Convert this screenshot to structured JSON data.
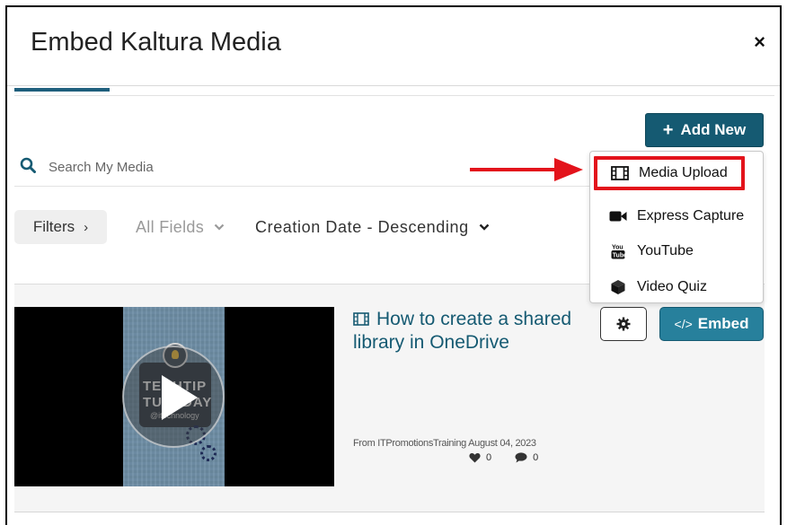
{
  "dialog": {
    "title": "Embed Kaltura Media",
    "close_label": "×"
  },
  "toolbar": {
    "add_new_label": "Add New",
    "search_placeholder": "Search My Media"
  },
  "filters": {
    "filters_label": "Filters",
    "fields_label": "All Fields",
    "sort_label": "Creation Date - Descending"
  },
  "add_new_menu": {
    "items": [
      {
        "label": "Media Upload",
        "icon": "film-icon",
        "highlighted": true
      },
      {
        "label": "Express Capture",
        "icon": "video-camera-icon"
      },
      {
        "label": "YouTube",
        "icon": "youtube-icon"
      },
      {
        "label": "Video Quiz",
        "icon": "cube-icon"
      }
    ]
  },
  "media_entry": {
    "title": "How to create a shared library in OneDrive",
    "thumbnail_text_line1": "TECHTIP",
    "thumbnail_text_line2": "TUESDAY",
    "thumbnail_sub": "@itechnology",
    "meta": "From ITPromotionsTraining August 04, 2023",
    "likes": "0",
    "comments": "0",
    "embed_label": "Embed"
  },
  "colors": {
    "accent": "#155a72",
    "embed": "#27809c",
    "highlight": "#e3131b"
  }
}
